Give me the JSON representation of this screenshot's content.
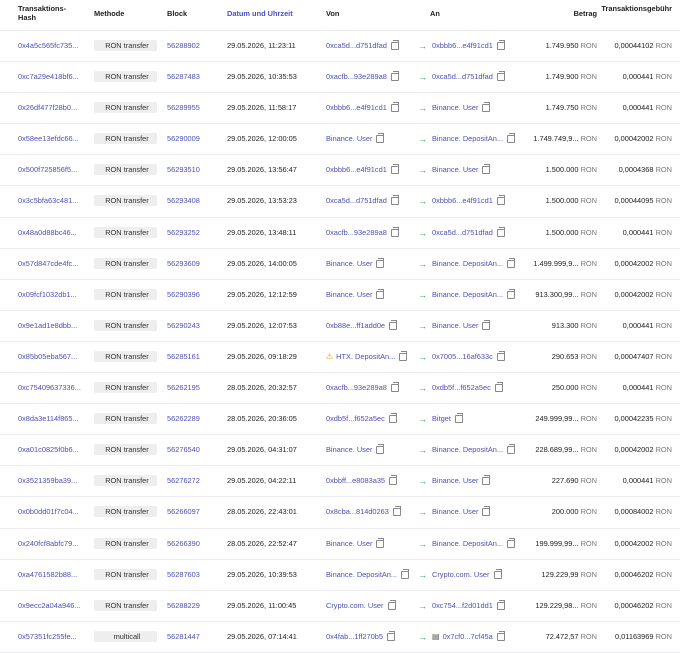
{
  "header": {
    "hash": "Transaktions-Hash",
    "method": "Methode",
    "block": "Block",
    "date": "Datum und Uhrzeit",
    "from": "Von",
    "to": "An",
    "amount": "Betrag",
    "fee": "Transaktionsgebühr"
  },
  "unit": "RON",
  "rows": [
    {
      "hash": "0x4a5c565fc735...",
      "method": "RON transfer",
      "block": "56288902",
      "date": "29.05.2026, 11:23:11",
      "from": "0xca5d...d751dfad",
      "from_copy": true,
      "to": "0xbbb6...e4f91cd1",
      "to_copy": true,
      "amount": "1.749.950",
      "fee": "0,00044102"
    },
    {
      "hash": "0xc7a29e418bf6...",
      "method": "RON transfer",
      "block": "56287483",
      "date": "29.05.2026, 10:35:53",
      "from": "0xacfb...93e289a8",
      "from_copy": true,
      "to": "0xca5d...d751dfad",
      "to_copy": true,
      "amount": "1.749.900",
      "fee": "0,000441"
    },
    {
      "hash": "0x26df477f28b0...",
      "method": "RON transfer",
      "block": "56289955",
      "date": "29.05.2026, 11:58:17",
      "from": "0xbbb6...e4f91cd1",
      "from_copy": true,
      "to": "Binance. User",
      "to_copy": true,
      "amount": "1.749.750",
      "fee": "0,000441"
    },
    {
      "hash": "0x58ee13efdc66...",
      "method": "RON transfer",
      "block": "56290009",
      "date": "29.05.2026, 12:00:05",
      "from": "Binance. User",
      "from_copy": true,
      "to": "Binance. DepositAn...",
      "to_copy": true,
      "amount": "1.749.749,9...",
      "fee": "0,00042002"
    },
    {
      "hash": "0x500f725856f5...",
      "method": "RON transfer",
      "block": "56293510",
      "date": "29.05.2026, 13:56:47",
      "from": "0xbbb6...e4f91cd1",
      "from_copy": true,
      "to": "Binance. User",
      "to_copy": true,
      "amount": "1.500.000",
      "fee": "0,0004368"
    },
    {
      "hash": "0x3c5bfa63c481...",
      "method": "RON transfer",
      "block": "56293408",
      "date": "29.05.2026, 13:53:23",
      "from": "0xca5d...d751dfad",
      "from_copy": true,
      "to": "0xbbb6...e4f91cd1",
      "to_copy": true,
      "amount": "1.500.000",
      "fee": "0,00044095"
    },
    {
      "hash": "0x48a0d88bc46...",
      "method": "RON transfer",
      "block": "56293252",
      "date": "29.05.2026, 13:48:11",
      "from": "0xacfb...93e289a8",
      "from_copy": true,
      "to": "0xca5d...d751dfad",
      "to_copy": true,
      "amount": "1.500.000",
      "fee": "0,000441"
    },
    {
      "hash": "0x57d847cde4fc...",
      "method": "RON transfer",
      "block": "56293609",
      "date": "29.05.2026, 14:00:05",
      "from": "Binance. User",
      "from_copy": true,
      "to": "Binance. DepositAn...",
      "to_copy": true,
      "amount": "1.499.999,9...",
      "fee": "0,00042002"
    },
    {
      "hash": "0x09fcf1032db1...",
      "method": "RON transfer",
      "block": "56290396",
      "date": "29.05.2026, 12:12:59",
      "from": "Binance. User",
      "from_copy": true,
      "to": "Binance. DepositAn...",
      "to_copy": true,
      "amount": "913.300,99...",
      "fee": "0,00042002"
    },
    {
      "hash": "0x9e1ad1e8dbb...",
      "method": "RON transfer",
      "block": "56290243",
      "date": "29.05.2026, 12:07:53",
      "from": "0xb88e...ff1add0e",
      "from_copy": true,
      "to": "Binance. User",
      "to_copy": true,
      "amount": "913.300",
      "fee": "0,000441"
    },
    {
      "hash": "0x85b05eba567...",
      "method": "RON transfer",
      "block": "56285161",
      "date": "29.05.2026, 09:18:29",
      "from": "HTX. DepositAn...",
      "from_warn": true,
      "from_copy": true,
      "to": "0x7005...16af633c",
      "to_copy": true,
      "amount": "290.653",
      "fee": "0,00047407"
    },
    {
      "hash": "0xc75409637336...",
      "method": "RON transfer",
      "block": "56262195",
      "date": "28.05.2026, 20:32:57",
      "from": "0xacfb...93e289a8",
      "from_copy": true,
      "to": "0xdb5f...f652a5ec",
      "to_copy": true,
      "amount": "250.000",
      "fee": "0,000441"
    },
    {
      "hash": "0x8da3e114f865...",
      "method": "RON transfer",
      "block": "56262289",
      "date": "28.05.2026, 20:36:05",
      "from": "0xdb5f...f652a5ec",
      "from_copy": true,
      "to": "Bitget",
      "to_copy": true,
      "amount": "249.999,99...",
      "fee": "0,00042235"
    },
    {
      "hash": "0xa01c0825f0b6...",
      "method": "RON transfer",
      "block": "56276540",
      "date": "29.05.2026, 04:31:07",
      "from": "Binance. User",
      "from_copy": true,
      "to": "Binance. DepositAn...",
      "to_copy": true,
      "amount": "228.689,99...",
      "fee": "0,00042002"
    },
    {
      "hash": "0x3521359ba39...",
      "method": "RON transfer",
      "block": "56276272",
      "date": "29.05.2026, 04:22:11",
      "from": "0xbbff...e8083a35",
      "from_copy": true,
      "to": "Binance. User",
      "to_copy": true,
      "amount": "227.690",
      "fee": "0,000441"
    },
    {
      "hash": "0x0b0dd01f7c04...",
      "method": "RON transfer",
      "block": "56266097",
      "date": "28.05.2026, 22:43:01",
      "from": "0x8cba...814d0263",
      "from_copy": true,
      "to": "Binance. User",
      "to_copy": true,
      "amount": "200.000",
      "fee": "0,00084002"
    },
    {
      "hash": "0x240fcf8abfc79...",
      "method": "RON transfer",
      "block": "56266390",
      "date": "28.05.2026, 22:52:47",
      "from": "Binance. User",
      "from_copy": true,
      "to": "Binance. DepositAn...",
      "to_copy": true,
      "amount": "199.999,99...",
      "fee": "0,00042002"
    },
    {
      "hash": "0xa4761582b88...",
      "method": "RON transfer",
      "block": "56287603",
      "date": "29.05.2026, 10:39:53",
      "from": "Binance. DepositAn...",
      "from_copy": true,
      "to": "Crypto.com. User",
      "to_copy": true,
      "amount": "129.229,99",
      "fee": "0,00046202"
    },
    {
      "hash": "0x9ecc2a04a946...",
      "method": "RON transfer",
      "block": "56288229",
      "date": "29.05.2026, 11:00:45",
      "from": "Crypto.com. User",
      "from_copy": true,
      "to": "0xc754...f2d01dd1",
      "to_copy": true,
      "amount": "129.229,98...",
      "fee": "0,00046202"
    },
    {
      "hash": "0x57351fc255fe...",
      "method": "multicall",
      "block": "56281447",
      "date": "29.05.2026, 07:14:41",
      "from": "0x4fab...1ff270b5",
      "from_copy": true,
      "to": "0x7cf0...7cf45a",
      "to_contract": true,
      "to_copy": true,
      "amount": "72.472,57",
      "fee": "0,01163969"
    }
  ]
}
